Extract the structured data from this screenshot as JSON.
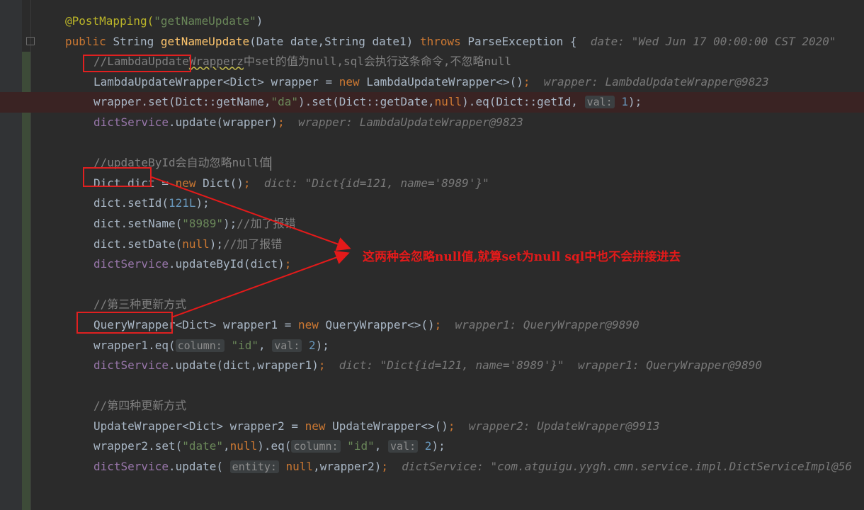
{
  "lines": [
    {
      "segments": [
        {
          "t": "@PostMapping(",
          "c": "ann"
        },
        {
          "t": "\"getNameUpdate\"",
          "c": "str"
        },
        {
          "t": ")",
          "c": ""
        }
      ]
    },
    {
      "segments": [
        {
          "t": "public ",
          "c": "kw"
        },
        {
          "t": "String ",
          "c": ""
        },
        {
          "t": "getNameUpdate",
          "c": "fn"
        },
        {
          "t": "(Date date,String date1) ",
          "c": ""
        },
        {
          "t": "throws ",
          "c": "kw"
        },
        {
          "t": "ParseException {  ",
          "c": ""
        },
        {
          "t": "date: \"Wed Jun 17 00:00:00 CST 2020\"",
          "c": "hint"
        }
      ]
    },
    {
      "indent": true,
      "segments": [
        {
          "t": "//LambdaUpdate",
          "c": "cmt"
        },
        {
          "t": "Wrapperz",
          "c": "cmt squig"
        },
        {
          "t": "中set的值为null,sql会执行这条命令,不忽略null",
          "c": "cmt"
        }
      ]
    },
    {
      "indent": true,
      "segments": [
        {
          "t": "LambdaUpdateWrapper<Dict> wrapper = ",
          "c": ""
        },
        {
          "t": "new ",
          "c": "kw"
        },
        {
          "t": "LambdaUpdateWrapper<>()",
          "c": ""
        },
        {
          "t": ";  ",
          "c": "kw"
        },
        {
          "t": "wrapper: LambdaUpdateWrapper@9823",
          "c": "hint"
        }
      ]
    },
    {
      "indent": true,
      "hl": true,
      "segments": [
        {
          "t": "wrapper.set(Dict::getName,",
          "c": ""
        },
        {
          "t": "\"da\"",
          "c": "str"
        },
        {
          "t": ").set(Dict::getDate,",
          "c": ""
        },
        {
          "t": "null",
          "c": "kw"
        },
        {
          "t": ").eq(Dict::getId, ",
          "c": ""
        },
        {
          "t": "val:",
          "c": "pill"
        },
        {
          "t": " ",
          "c": ""
        },
        {
          "t": "1",
          "c": "num"
        },
        {
          "t": ");",
          "c": ""
        }
      ]
    },
    {
      "indent": true,
      "segments": [
        {
          "t": "dictService",
          "c": "fld"
        },
        {
          "t": ".update(wrapper)",
          "c": ""
        },
        {
          "t": ";  ",
          "c": "kw"
        },
        {
          "t": "wrapper: LambdaUpdateWrapper@9823",
          "c": "hint"
        }
      ]
    },
    {
      "segments": []
    },
    {
      "indent": true,
      "caret": true,
      "segments": [
        {
          "t": "//updateById会自动忽略null值",
          "c": "cmt"
        }
      ]
    },
    {
      "indent": true,
      "segments": [
        {
          "t": "Dict dict = ",
          "c": ""
        },
        {
          "t": "new ",
          "c": "kw"
        },
        {
          "t": "Dict()",
          "c": ""
        },
        {
          "t": ";  ",
          "c": "kw"
        },
        {
          "t": "dict: \"Dict{id=121, name='8989'}\"",
          "c": "hint"
        }
      ]
    },
    {
      "indent": true,
      "segments": [
        {
          "t": "dict.setId(",
          "c": ""
        },
        {
          "t": "121L",
          "c": "num"
        },
        {
          "t": ");",
          "c": ""
        }
      ]
    },
    {
      "indent": true,
      "segments": [
        {
          "t": "dict.setName(",
          "c": ""
        },
        {
          "t": "\"8989\"",
          "c": "str"
        },
        {
          "t": ");",
          "c": ""
        },
        {
          "t": "//加了报错",
          "c": "cmt"
        }
      ]
    },
    {
      "indent": true,
      "segments": [
        {
          "t": "dict.setDate(",
          "c": ""
        },
        {
          "t": "null",
          "c": "kw"
        },
        {
          "t": ");",
          "c": ""
        },
        {
          "t": "//加了报错",
          "c": "cmt"
        }
      ]
    },
    {
      "indent": true,
      "segments": [
        {
          "t": "dictService",
          "c": "fld"
        },
        {
          "t": ".updateById(dict)",
          "c": ""
        },
        {
          "t": ";",
          "c": "kw"
        }
      ]
    },
    {
      "segments": []
    },
    {
      "indent": true,
      "segments": [
        {
          "t": "//第三种更新方式",
          "c": "cmt"
        }
      ]
    },
    {
      "indent": true,
      "segments": [
        {
          "t": "QueryWrapper<Dict> wrapper1 = ",
          "c": ""
        },
        {
          "t": "new ",
          "c": "kw"
        },
        {
          "t": "QueryWrapper<>()",
          "c": ""
        },
        {
          "t": ";  ",
          "c": "kw"
        },
        {
          "t": "wrapper1: QueryWrapper@9890",
          "c": "hint"
        }
      ]
    },
    {
      "indent": true,
      "segments": [
        {
          "t": "wrapper1.eq(",
          "c": ""
        },
        {
          "t": "column:",
          "c": "pill"
        },
        {
          "t": " ",
          "c": ""
        },
        {
          "t": "\"id\"",
          "c": "str"
        },
        {
          "t": ", ",
          "c": ""
        },
        {
          "t": "val:",
          "c": "pill"
        },
        {
          "t": " ",
          "c": ""
        },
        {
          "t": "2",
          "c": "num"
        },
        {
          "t": ");",
          "c": ""
        }
      ]
    },
    {
      "indent": true,
      "segments": [
        {
          "t": "dictService",
          "c": "fld"
        },
        {
          "t": ".update(dict,wrapper1)",
          "c": ""
        },
        {
          "t": ";  ",
          "c": "kw"
        },
        {
          "t": "dict: \"Dict{id=121, name='8989'}\"  wrapper1: QueryWrapper@9890",
          "c": "hint"
        }
      ]
    },
    {
      "segments": []
    },
    {
      "indent": true,
      "segments": [
        {
          "t": "//第四种更新方式",
          "c": "cmt"
        }
      ]
    },
    {
      "indent": true,
      "segments": [
        {
          "t": "UpdateWrapper<Dict> wrapper2 = ",
          "c": ""
        },
        {
          "t": "new ",
          "c": "kw"
        },
        {
          "t": "UpdateWrapper<>()",
          "c": ""
        },
        {
          "t": ";  ",
          "c": "kw"
        },
        {
          "t": "wrapper2: UpdateWrapper@9913",
          "c": "hint"
        }
      ]
    },
    {
      "indent": true,
      "segments": [
        {
          "t": "wrapper2.set(",
          "c": ""
        },
        {
          "t": "\"date\"",
          "c": "str"
        },
        {
          "t": ",",
          "c": ""
        },
        {
          "t": "null",
          "c": "kw"
        },
        {
          "t": ").eq(",
          "c": ""
        },
        {
          "t": "column:",
          "c": "pill"
        },
        {
          "t": " ",
          "c": ""
        },
        {
          "t": "\"id\"",
          "c": "str"
        },
        {
          "t": ", ",
          "c": ""
        },
        {
          "t": "val:",
          "c": "pill"
        },
        {
          "t": " ",
          "c": ""
        },
        {
          "t": "2",
          "c": "num"
        },
        {
          "t": ");",
          "c": ""
        }
      ]
    },
    {
      "indent": true,
      "segments": [
        {
          "t": "dictService",
          "c": "fld"
        },
        {
          "t": ".update( ",
          "c": ""
        },
        {
          "t": "entity:",
          "c": "pill"
        },
        {
          "t": " ",
          "c": ""
        },
        {
          "t": "null",
          "c": "kw"
        },
        {
          "t": ",wrapper2)",
          "c": ""
        },
        {
          "t": ";  ",
          "c": "kw"
        },
        {
          "t": "dictService: \"com.atguigu.yygh.cmn.service.impl.DictServiceImpl@56",
          "c": "hint"
        }
      ]
    }
  ],
  "annotation": {
    "text": "这两种会忽略null值,就算set为null sql中也不会拼接进去",
    "color": "#e41a1a"
  },
  "colors": {
    "background": "#2b2b2b",
    "keyword": "#cc7832",
    "string": "#6a8759",
    "number": "#6897bb",
    "annotation": "#bbb529",
    "comment": "#808080",
    "field": "#9876aa",
    "function": "#ffc66d"
  }
}
